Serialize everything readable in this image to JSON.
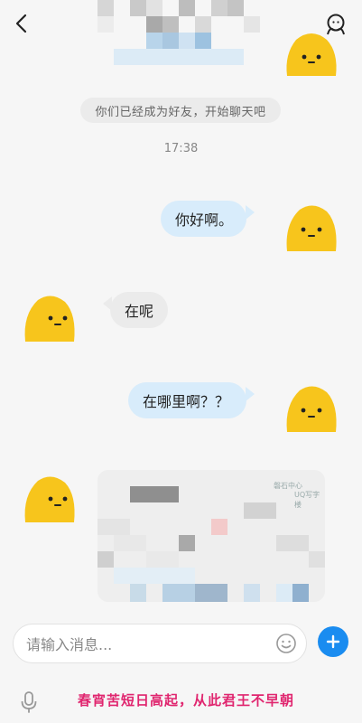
{
  "header": {
    "back_icon": "chevron-left-icon",
    "profile_icon": "user-profile-icon"
  },
  "chat": {
    "system_note": "你们已经成为好友，开始聊天吧",
    "timestamp": "17:38",
    "messages": [
      {
        "direction": "outgoing",
        "text": "你好啊。"
      },
      {
        "direction": "incoming",
        "text": "在呢"
      },
      {
        "direction": "outgoing",
        "text": "在哪里啊？？"
      },
      {
        "direction": "incoming",
        "type": "location-map"
      }
    ],
    "map_labels": [
      "磐石中心",
      "UQ写字楼"
    ]
  },
  "composer": {
    "placeholder": "请输入消息...",
    "emoji_icon": "smiley-icon",
    "plus_icon": "plus-icon",
    "mic_icon": "microphone-icon"
  },
  "signature": "春宵苦短日高起，从此君王不早朝",
  "colors": {
    "outgoing_bubble": "#d8ecfb",
    "incoming_bubble": "#ebebeb",
    "accent": "#1a8cf0",
    "avatar": "#f7c51c",
    "signature": "#e0266f"
  }
}
